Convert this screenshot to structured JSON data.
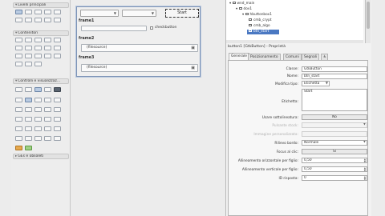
{
  "toolbox": {
    "sections": [
      "Livelli principali",
      "Contenitori",
      "Controlli e visualizzaz...",
      "GEs e obsoleti"
    ]
  },
  "form": {
    "start_button": "Start",
    "checkbutton_label": "checkbutton",
    "frames": [
      {
        "label": "frame1"
      },
      {
        "label": "frame2",
        "field": "(filesource)"
      },
      {
        "label": "frame3",
        "field": "(filesource)"
      }
    ]
  },
  "tree": {
    "nodes": [
      "wnd_main",
      "dov1",
      "hbuttonbox1",
      "cmb_crypt",
      "cmb_algo",
      "btn_start"
    ]
  },
  "properties": {
    "title": "button1 [GtkButton] - Proprietà",
    "tabs": [
      "Generale",
      "Posizionamento",
      "Comuni",
      "Segnali"
    ],
    "rows": [
      {
        "label": "Classe:",
        "value": "GtkButton"
      },
      {
        "label": "Nome:",
        "value": "btn_start"
      },
      {
        "label": "Modifica tipo:",
        "value": "Etichetta"
      },
      {
        "label": "Etichetta:",
        "value": "Start"
      },
      {
        "label": "Usare sottolineatura:",
        "value": "No"
      },
      {
        "label": "Pulsante stock:",
        "value": ""
      },
      {
        "label": "Immagine personalizzata:",
        "value": ""
      },
      {
        "label": "Rilievo bordo:",
        "value": "Normale"
      },
      {
        "label": "Focus al clic:",
        "value": "Sì"
      },
      {
        "label": "Allineamento orizzontale per figlio:",
        "value": "0,50"
      },
      {
        "label": "Allineamento verticale per figlio:",
        "value": "0,50"
      },
      {
        "label": "ID risposta:",
        "value": "0"
      }
    ]
  }
}
